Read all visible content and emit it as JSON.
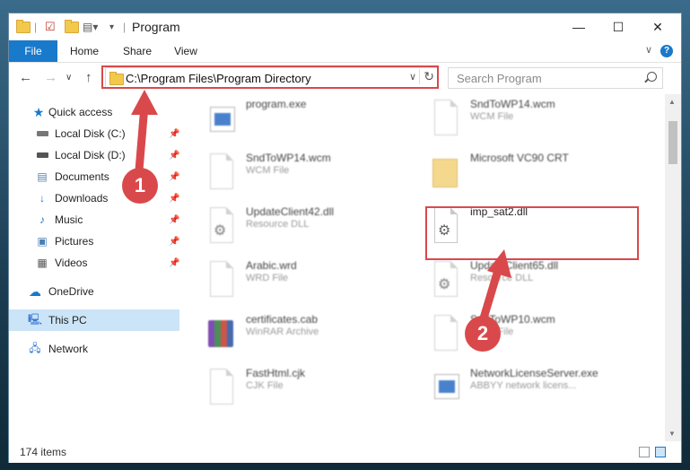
{
  "window": {
    "title": "Program",
    "controls": {
      "minimize": "—",
      "maximize": "☐",
      "close": "✕"
    }
  },
  "ribbon": {
    "tabs": [
      "File",
      "Home",
      "Share",
      "View"
    ],
    "help": "?",
    "expand": "∨"
  },
  "navigation": {
    "back": "←",
    "forward": "→",
    "recent": "∨",
    "up": "↑",
    "address": "C:\\Program Files\\Program Directory",
    "address_dropdown": "∨",
    "refresh": "↻",
    "search_placeholder": "Search Program"
  },
  "sidebar": {
    "items": [
      {
        "label": "Quick access",
        "icon": "star-icon",
        "pinned": false
      },
      {
        "label": "Local Disk (C:)",
        "icon": "drive-icon",
        "pinned": true
      },
      {
        "label": "Local Disk (D:)",
        "icon": "drive-icon",
        "pinned": true
      },
      {
        "label": "Documents",
        "icon": "documents-icon",
        "pinned": true
      },
      {
        "label": "Downloads",
        "icon": "download-icon",
        "pinned": true
      },
      {
        "label": "Music",
        "icon": "music-icon",
        "pinned": true
      },
      {
        "label": "Pictures",
        "icon": "pictures-icon",
        "pinned": true
      },
      {
        "label": "Videos",
        "icon": "videos-icon",
        "pinned": true
      },
      {
        "label": "OneDrive",
        "icon": "cloud-icon",
        "pinned": false
      },
      {
        "label": "This PC",
        "icon": "computer-icon",
        "pinned": false,
        "selected": true
      },
      {
        "label": "Network",
        "icon": "network-icon",
        "pinned": false
      }
    ],
    "pin_glyph": "📌"
  },
  "files": [
    {
      "name": "program.exe",
      "type": "",
      "icon": "program-exe-icon"
    },
    {
      "name": "SndToWP14.wcm",
      "type": "WCM File",
      "icon": "file-icon"
    },
    {
      "name": "SndToWP14.wcm",
      "type": "WCM File",
      "icon": "file-icon"
    },
    {
      "name": "Microsoft VC90 CRT",
      "type": "",
      "icon": "folder-icon"
    },
    {
      "name": "UpdateClient42.dll",
      "type": "Resource DLL",
      "icon": "dll-icon"
    },
    {
      "name": "imp_sat2.dll",
      "type": "",
      "icon": "dll-icon",
      "highlighted": true
    },
    {
      "name": "Arabic.wrd",
      "type": "WRD File",
      "icon": "file-icon"
    },
    {
      "name": "UpdateClient65.dll",
      "type": "Resource DLL",
      "icon": "dll-icon"
    },
    {
      "name": "certificates.cab",
      "type": "WinRAR Archive",
      "icon": "archive-icon"
    },
    {
      "name": "SndToWP10.wcm",
      "type": "WCM File",
      "icon": "file-icon"
    },
    {
      "name": "FastHtml.cjk",
      "type": "CJK File",
      "icon": "file-icon"
    },
    {
      "name": "NetworkLicenseServer.exe",
      "type": "ABBYY network licens...",
      "icon": "exe-icon"
    }
  ],
  "status": {
    "item_count": "174 items"
  },
  "annotations": {
    "marker1": "1",
    "marker2": "2",
    "color": "#d9494b"
  },
  "colors": {
    "accent": "#1979ca",
    "selection": "#cce4f7"
  }
}
